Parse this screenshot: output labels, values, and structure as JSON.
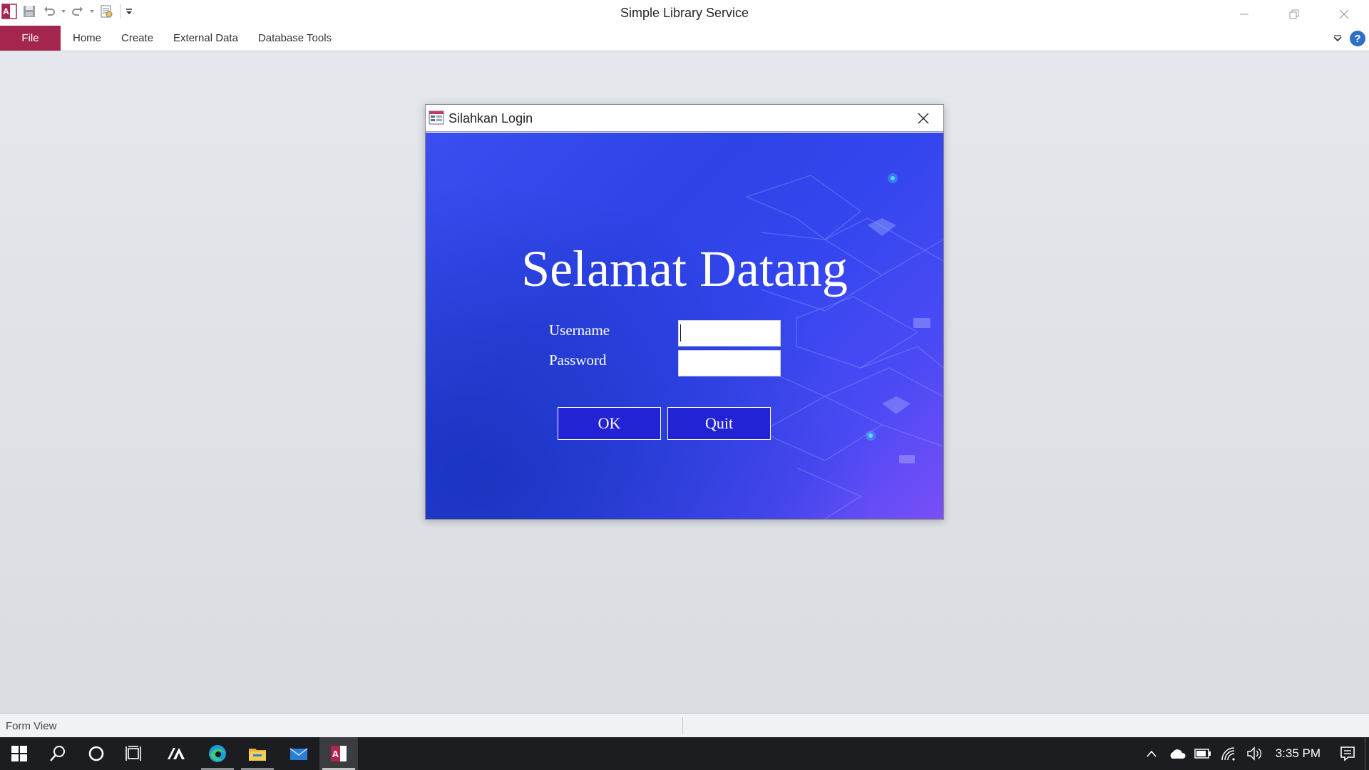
{
  "window": {
    "title": "Simple Library Service",
    "qat_icons": [
      "access-app-icon",
      "save-icon",
      "undo-icon",
      "redo-icon",
      "print-preview-icon",
      "customize-qat-icon"
    ],
    "controls": [
      "minimize-icon",
      "restore-icon",
      "close-icon"
    ]
  },
  "ribbon": {
    "file_label": "File",
    "tabs": [
      "Home",
      "Create",
      "External Data",
      "Database Tools"
    ],
    "accent": "#a4264f"
  },
  "dialog": {
    "title": "Silahkan Login",
    "welcome": "Selamat Datang",
    "username_label": "Username",
    "password_label": "Password",
    "username_value": "",
    "password_value": "",
    "ok_label": "OK",
    "quit_label": "Quit",
    "background_color": "#3346ee",
    "button_color": "#2323d6"
  },
  "statusbar": {
    "text": "Form View"
  },
  "taskbar": {
    "apps": [
      "windows-start-icon",
      "search-icon",
      "cortana-icon",
      "task-view-icon",
      "app-icon",
      "edge-icon",
      "file-explorer-icon",
      "mail-icon",
      "access-icon"
    ],
    "clock": "3:35 PM"
  }
}
